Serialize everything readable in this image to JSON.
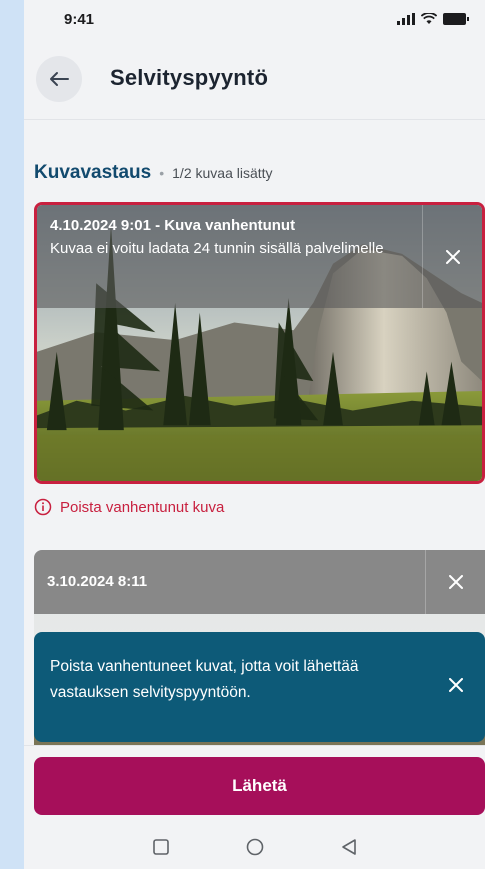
{
  "status_bar": {
    "time": "9:41"
  },
  "header": {
    "title": "Selvityspyyntö",
    "back_icon": "arrow-left-icon"
  },
  "section": {
    "title": "Kuvavastaus",
    "separator": "•",
    "count": "1/2 kuvaa lisätty"
  },
  "photos": [
    {
      "title": "4.10.2024 9:01 - Kuva vanhentunut",
      "message": "Kuvaa ei voitu ladata 24 tunnin sisällä palvelimelle",
      "state": "expired",
      "close_icon": "close-icon"
    },
    {
      "title": "3.10.2024 8:11",
      "close_icon": "close-icon"
    }
  ],
  "error": {
    "text": "Poista vanhentunut kuva",
    "icon": "info-circle-icon"
  },
  "toast": {
    "text": "Poista vanhentuneet kuvat, jotta voit lähettää vastauksen selvityspyyntöön.",
    "close_icon": "close-icon"
  },
  "actions": {
    "send_label": "Lähetä"
  },
  "navigation": {
    "icons": [
      "square-icon",
      "circle-icon",
      "triangle-back-icon"
    ]
  },
  "colors": {
    "error": "#c8203f",
    "primary_button": "#a60f5a",
    "toast_background": "#0d5a78",
    "section_title": "#124a6e"
  }
}
